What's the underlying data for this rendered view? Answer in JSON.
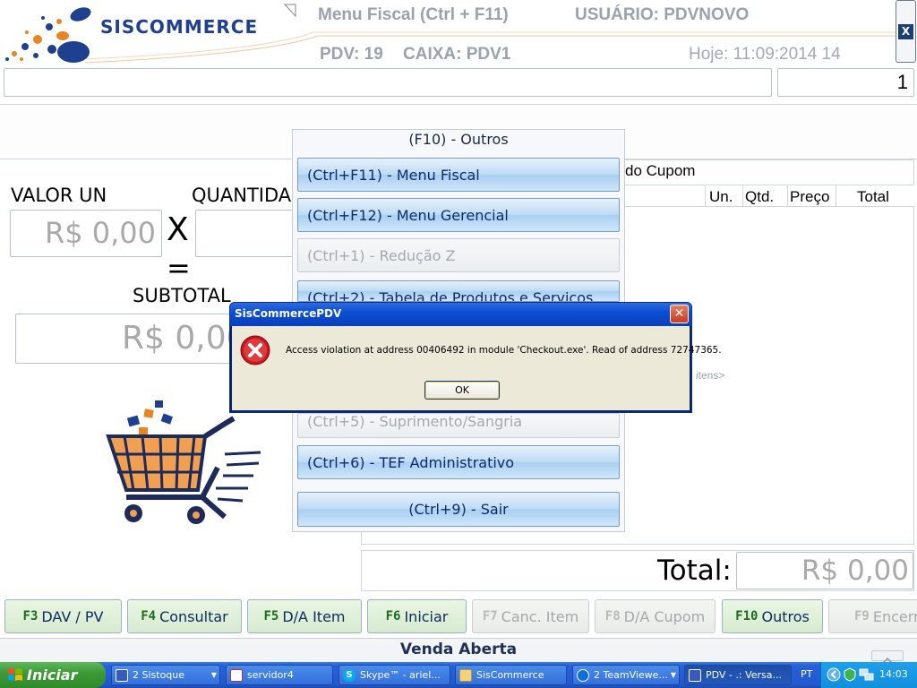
{
  "header": {
    "brand": "SISCOMMERCE",
    "menu_title": "Menu Fiscal (Ctrl + F11)",
    "user": "USUÁRIO: PDVNOVO",
    "pdv": "PDV: 19",
    "caixa": "CAIXA: PDV1",
    "date": "Hoje: 11:09:2014 14",
    "close_label": "X"
  },
  "inputs": {
    "search_value": "",
    "quantity_value": "1"
  },
  "left_panel": {
    "valor_un_label": "VALOR UN",
    "valor_un_value": "R$ 0,00",
    "multiply": "X",
    "quantidade_label": "QUANTIDA",
    "equals": "=",
    "subtotal_label": "SUBTOTAL",
    "subtotal_value": "R$ 0,00"
  },
  "cupom": {
    "title_fragment": "do Cupom",
    "columns": [
      "Un.",
      "Qtd.",
      "Preço",
      "Total"
    ],
    "empty_fragment": "itens>"
  },
  "total": {
    "label": "Total:",
    "value": "R$ 0,00"
  },
  "outros_menu": {
    "title": "(F10) - Outros",
    "items": [
      {
        "label": "(Ctrl+F11) - Menu Fiscal",
        "enabled": true
      },
      {
        "label": "(Ctrl+F12) - Menu Gerencial",
        "enabled": true
      },
      {
        "label": "(Ctrl+1) - Redução Z",
        "enabled": false
      },
      {
        "label": "(Ctrl+2) - Tabela de Produtos e Serviços",
        "enabled": true
      },
      {
        "label": "(Ctrl+5) - Suprimento/Sangria",
        "enabled": false
      },
      {
        "label": "(Ctrl+6) - TEF Administrativo",
        "enabled": true
      },
      {
        "label": "(Ctrl+9) - Sair",
        "enabled": true
      }
    ]
  },
  "dialog": {
    "title": "SisCommercePDV",
    "message": "Access violation at address 00406492 in module 'Checkout.exe'. Read of address 72747365.",
    "ok_label": "OK",
    "icon": "error-icon"
  },
  "function_keys": [
    {
      "key": "F3",
      "label": "DAV / PV",
      "enabled": true
    },
    {
      "key": "F4",
      "label": "Consultar",
      "enabled": true
    },
    {
      "key": "F5",
      "label": "D/A Item",
      "enabled": true
    },
    {
      "key": "F6",
      "label": "Iniciar",
      "enabled": true
    },
    {
      "key": "F7",
      "label": "Canc. Item",
      "enabled": false
    },
    {
      "key": "F8",
      "label": "D/A Cupom",
      "enabled": false
    },
    {
      "key": "F10",
      "label": "Outros",
      "enabled": true
    },
    {
      "key": "F9",
      "label": "Encerr",
      "enabled": false
    }
  ],
  "status": "Venda Aberta",
  "taskbar": {
    "start": "Iniciar",
    "tasks": [
      {
        "label": "2 Sistoque",
        "icon": "app-icon"
      },
      {
        "label": "servidor4",
        "icon": "remote-icon"
      },
      {
        "label": "Skype™ - ariel...",
        "icon": "skype-icon"
      },
      {
        "label": "SisCommerce",
        "icon": "folder-icon"
      },
      {
        "label": "2 TeamViewe...",
        "icon": "teamviewer-icon"
      },
      {
        "label": "PDV - .: Versa...",
        "icon": "pdv-icon"
      }
    ],
    "language": "PT",
    "clock": "14:03"
  },
  "colors": {
    "accent_blue": "#1f3f8f",
    "menu_button": "#bfdcf5",
    "fkey_green": "#1b6b20",
    "taskbar": "#2459cf",
    "dialog_title": "#0b4ed4"
  }
}
